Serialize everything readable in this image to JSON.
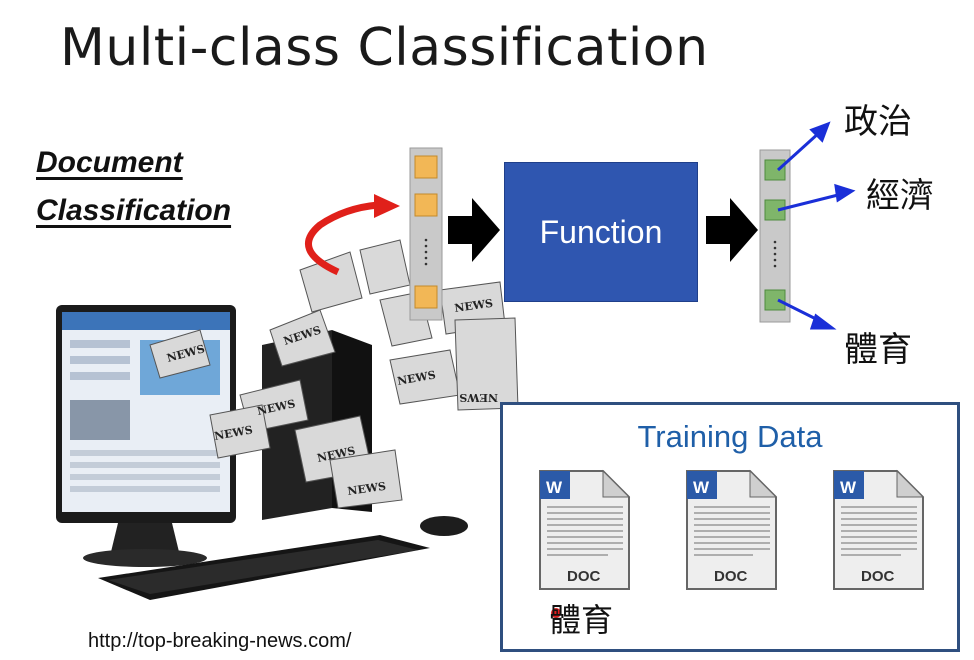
{
  "title": "Multi-class Classification",
  "document_classification": {
    "line1": "Document",
    "line2": "Classification"
  },
  "function_box": {
    "label": "Function"
  },
  "outputs": [
    "政治",
    "經濟",
    "體育"
  ],
  "training": {
    "title": "Training Data",
    "docs": [
      {
        "icon_letter": "W",
        "label": "DOC"
      },
      {
        "icon_letter": "W",
        "label": "DOC"
      },
      {
        "icon_letter": "W",
        "label": "DOC"
      }
    ],
    "example_label": "體育"
  },
  "source_url": "http://top-breaking-news.com/",
  "news_word": "NEWS",
  "colors": {
    "function_fill": "#2f56b0",
    "input_cell": "#f2b756",
    "output_cell": "#7fb56a",
    "arrow_blue": "#1a2fd8",
    "arrow_red": "#e0201a",
    "training_title": "#1f5fa8"
  }
}
